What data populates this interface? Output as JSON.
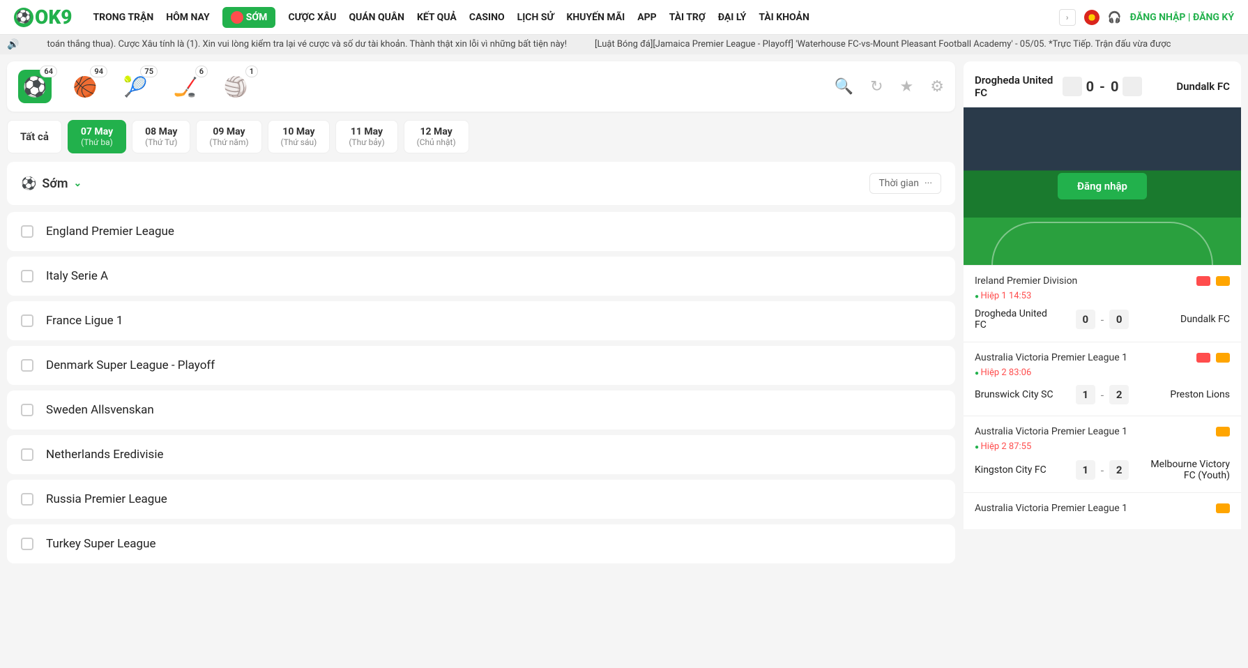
{
  "logo": "OK9",
  "nav": [
    "TRONG TRẬN",
    "HÔM NAY",
    "SỚM",
    "CƯỢC XÂU",
    "QUÁN QUÂN",
    "KẾT QUẢ",
    "CASINO",
    "LỊCH SỬ",
    "KHUYẾN MÃI",
    "APP",
    "TÀI TRỢ",
    "ĐẠI LÝ",
    "TÀI KHOẢN"
  ],
  "auth": {
    "login": "ĐĂNG NHẬP",
    "sep": " | ",
    "register": "ĐĂNG KÝ"
  },
  "ticker": {
    "msg1": "toán thắng thua). Cược Xâu tính là (1). Xin vui lòng kiểm tra lại vé cược và số dư tài khoản. Thành thật xin lỗi vì những bất tiện này!",
    "msg2": "[Luật Bóng đá][Jamaica Premier League - Playoff] 'Waterhouse FC-vs-Mount Pleasant Football Academy' - 05/05. *Trực Tiếp. Trận đấu vừa được"
  },
  "sports": [
    {
      "emoji": "⚽",
      "count": "64",
      "active": true
    },
    {
      "emoji": "🏀",
      "count": "94"
    },
    {
      "emoji": "🎾",
      "count": "75"
    },
    {
      "emoji": "🏒",
      "count": "6"
    },
    {
      "emoji": "🏐",
      "count": "1"
    }
  ],
  "dateTabs": {
    "all": "Tất cả",
    "items": [
      {
        "d1": "07 May",
        "d2": "(Thứ ba)",
        "active": true
      },
      {
        "d1": "08 May",
        "d2": "(Thứ Tư)"
      },
      {
        "d1": "09 May",
        "d2": "(Thứ năm)"
      },
      {
        "d1": "10 May",
        "d2": "(Thứ sáu)"
      },
      {
        "d1": "11 May",
        "d2": "(Thư bảy)"
      },
      {
        "d1": "12 May",
        "d2": "(Chủ nhật)"
      }
    ]
  },
  "section": {
    "title": "Sớm",
    "sort": "Thời gian",
    "dots": "···"
  },
  "leagues": [
    "England Premier League",
    "Italy Serie A",
    "France Ligue 1",
    "Denmark Super League - Playoff",
    "Sweden Allsvenskan",
    "Netherlands Eredivisie",
    "Russia Premier League",
    "Turkey Super League"
  ],
  "featured": {
    "home": "Drogheda United FC",
    "away": "Dundalk FC",
    "score1": "0",
    "dash": "-",
    "score2": "0",
    "loginBtn": "Đăng nhập"
  },
  "liveCards": [
    {
      "league": "Ireland Premier Division",
      "tv": true,
      "pitch": true,
      "status": "Hiệp 1 14:53",
      "home": "Drogheda United FC",
      "s1": "0",
      "s2": "0",
      "away": "Dundalk FC"
    },
    {
      "league": "Australia Victoria Premier League 1",
      "tv": true,
      "pitch": true,
      "status": "Hiệp 2 83:06",
      "home": "Brunswick City SC",
      "s1": "1",
      "s2": "2",
      "away": "Preston Lions"
    },
    {
      "league": "Australia Victoria Premier League 1",
      "tv": false,
      "pitch": true,
      "status": "Hiệp 2 87:55",
      "home": "Kingston City FC",
      "s1": "1",
      "s2": "2",
      "away": "Melbourne Victory FC (Youth)"
    },
    {
      "league": "Australia Victoria Premier League 1",
      "tv": false,
      "pitch": true,
      "partial": true
    }
  ]
}
